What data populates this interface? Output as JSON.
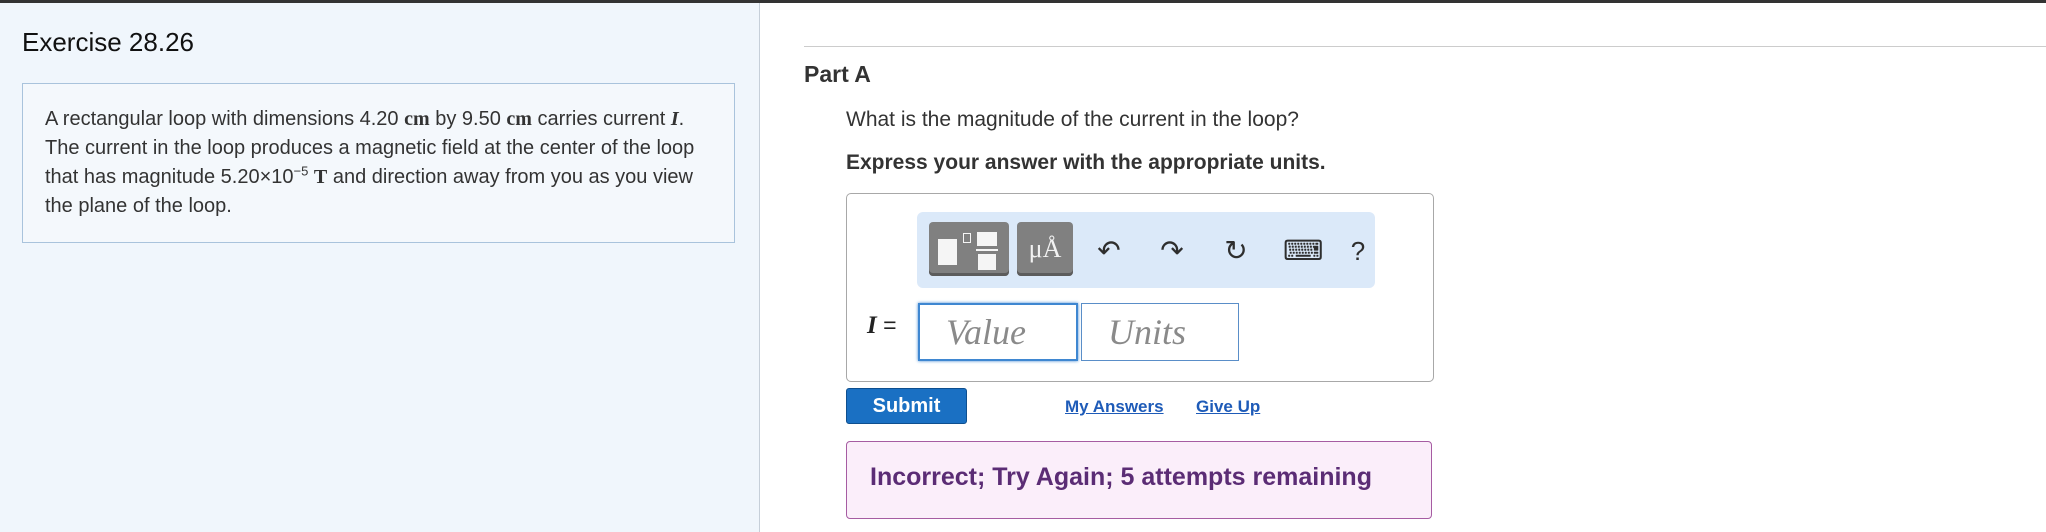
{
  "exercise": {
    "title": "Exercise 28.26"
  },
  "problem": {
    "text_1": "A rectangular loop with dimensions 4.20 ",
    "unit_cm_1": "cm",
    "text_2": " by 9.50 ",
    "unit_cm_2": "cm",
    "text_3": " carries current ",
    "var_I": "I",
    "text_4": ". The current in the loop produces a magnetic field at the center of the loop that has magnitude 5.20×10",
    "exponent": "−5",
    "text_5": " ",
    "unit_T": "T",
    "text_6": " and direction away from you as you view the plane of the loop."
  },
  "part": {
    "title": "Part A",
    "question": "What is the magnitude of the current in the loop?",
    "instruction": "Express your answer with the appropriate units."
  },
  "toolbar": {
    "units_label": "μÅ",
    "undo_icon": "↶",
    "redo_icon": "↷",
    "reset_icon": "↻",
    "keyboard_icon": "⌨",
    "help_label": "?"
  },
  "answer": {
    "variable": "I",
    "equals": " =",
    "value_placeholder": "Value",
    "value": "",
    "units_placeholder": "Units",
    "units": ""
  },
  "actions": {
    "submit_label": "Submit",
    "my_answers_label": "My Answers",
    "give_up_label": "Give Up"
  },
  "feedback": {
    "message": "Incorrect; Try Again; 5 attempts remaining"
  },
  "colors": {
    "accent": "#1a70c3",
    "feedback_bg": "#fbeefa",
    "feedback_text": "#5b2c75",
    "left_panel_bg": "#f0f6fc"
  }
}
